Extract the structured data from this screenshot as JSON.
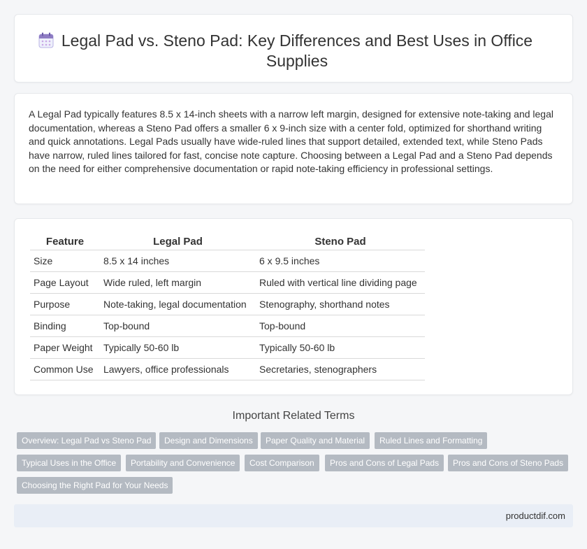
{
  "header": {
    "title": "Legal Pad vs. Steno Pad: Key Differences and Best Uses in Office Supplies",
    "icon": "calendar-icon"
  },
  "intro": {
    "text": "A Legal Pad typically features 8.5 x 14-inch sheets with a narrow left margin, designed for extensive note-taking and legal documentation, whereas a Steno Pad offers a smaller 6 x 9-inch size with a center fold, optimized for shorthand writing and quick annotations. Legal Pads usually have wide-ruled lines that support detailed, extended text, while Steno Pads have narrow, ruled lines tailored for fast, concise note capture. Choosing between a Legal Pad and a Steno Pad depends on the need for either comprehensive documentation or rapid note-taking efficiency in professional settings."
  },
  "table": {
    "headers": [
      "Feature",
      "Legal Pad",
      "Steno Pad"
    ],
    "rows": [
      [
        "Size",
        "8.5 x 14 inches",
        "6 x 9.5 inches"
      ],
      [
        "Page Layout",
        "Wide ruled, left margin",
        "Ruled with vertical line dividing page"
      ],
      [
        "Purpose",
        "Note-taking, legal documentation",
        "Stenography, shorthand notes"
      ],
      [
        "Binding",
        "Top-bound",
        "Top-bound"
      ],
      [
        "Paper Weight",
        "Typically 50-60 lb",
        "Typically 50-60 lb"
      ],
      [
        "Common Use",
        "Lawyers, office professionals",
        "Secretaries, stenographers"
      ]
    ]
  },
  "related": {
    "title": "Important Related Terms",
    "tags": [
      "Overview: Legal Pad vs Steno Pad",
      "Design and Dimensions",
      "Paper Quality and Material",
      "Ruled Lines and Formatting",
      "Typical Uses in the Office",
      "Portability and Convenience",
      "Cost Comparison",
      "Pros and Cons of Legal Pads",
      "Pros and Cons of Steno Pads",
      "Choosing the Right Pad for Your Needs"
    ]
  },
  "footer": {
    "site": "productdif.com"
  },
  "colors": {
    "tag_bg": "#b4bac2",
    "footer_bg": "#e9eef6",
    "icon_accent": "#8e7cc3"
  }
}
